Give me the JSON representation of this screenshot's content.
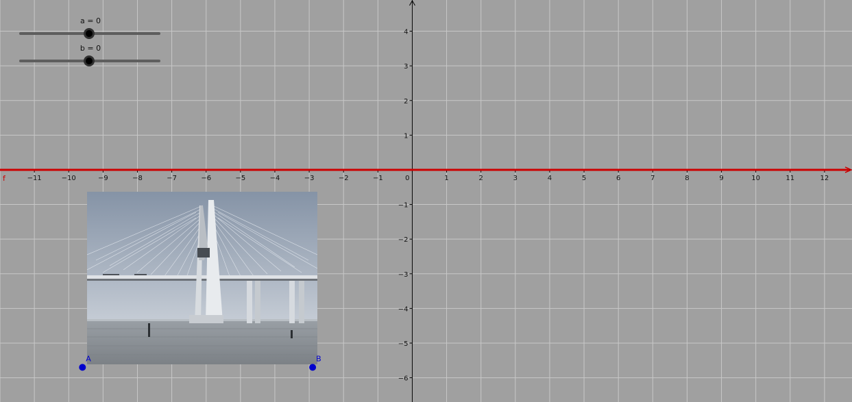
{
  "graphing_view": {
    "background": "#a0a0a0",
    "grid_color": "#c8c8c8",
    "axis_color": "#000000",
    "x_range": [
      -12,
      12.8
    ],
    "y_range": [
      -6.7,
      4.9
    ],
    "x_tick_labels": [
      "−11",
      "−10",
      "−9",
      "−8",
      "−7",
      "−6",
      "−5",
      "−4",
      "−3",
      "−2",
      "−1",
      "0",
      "1",
      "2",
      "3",
      "4",
      "5",
      "6",
      "7",
      "8",
      "9",
      "10",
      "11",
      "12"
    ],
    "y_tick_labels": [
      "4",
      "3",
      "2",
      "1",
      "−1",
      "−2",
      "−3",
      "−4",
      "−5",
      "−6"
    ]
  },
  "function": {
    "name": "f",
    "color": "#cc0000",
    "y": 0
  },
  "sliders": [
    {
      "name": "a",
      "label": "a = 0",
      "value": 0,
      "min": -2,
      "max": 2
    },
    {
      "name": "b",
      "label": "b = 0",
      "value": 0,
      "min": -2,
      "max": 2
    }
  ],
  "points": [
    {
      "name": "A",
      "x": -9.6,
      "y": -5.7,
      "color": "#0000cc"
    },
    {
      "name": "B",
      "x": -2.9,
      "y": -5.7,
      "color": "#0000cc"
    }
  ],
  "image": {
    "subject": "cable-stayed bridge photo",
    "corner_A": "A",
    "corner_B": "B"
  }
}
